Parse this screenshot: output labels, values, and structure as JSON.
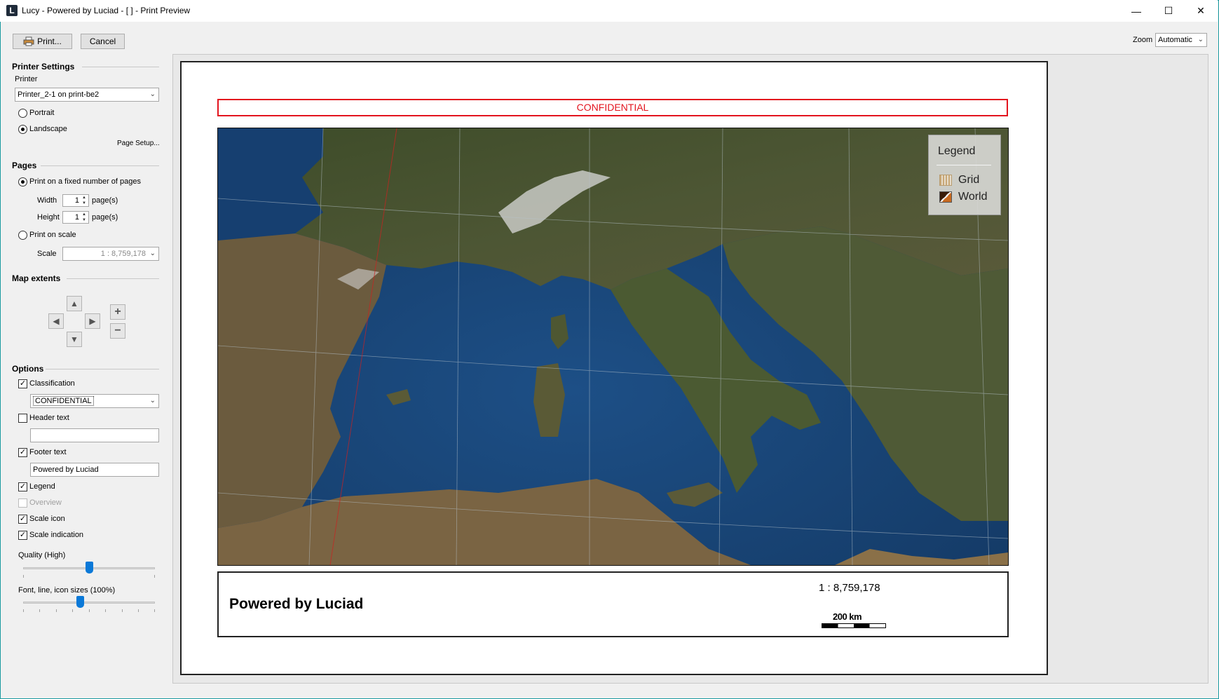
{
  "window": {
    "title": "Lucy - Powered by Luciad - [ ] - Print Preview",
    "app_icon": "L",
    "controls": {
      "minimize": "—",
      "maximize": "☐",
      "close": "✕"
    }
  },
  "toolbar": {
    "print_label": "Print...",
    "cancel_label": "Cancel",
    "zoom_label": "Zoom",
    "zoom_value": "Automatic"
  },
  "printer_settings": {
    "heading": "Printer Settings",
    "printer_label": "Printer",
    "printer_value": "Printer_2-1 on print-be2",
    "portrait_label": "Portrait",
    "landscape_label": "Landscape",
    "orientation": "Landscape",
    "page_setup_label": "Page Setup..."
  },
  "pages": {
    "heading": "Pages",
    "fixed_pages_label": "Print on a fixed number of pages",
    "width_label": "Width",
    "width_value": "1",
    "height_label": "Height",
    "height_value": "1",
    "pages_unit": "page(s)",
    "print_on_scale_label": "Print on scale",
    "scale_label": "Scale",
    "scale_value": "1 : 8,759,178"
  },
  "map_extents": {
    "heading": "Map extents"
  },
  "options": {
    "heading": "Options",
    "classification_label": "Classification",
    "classification_checked": true,
    "classification_value": "CONFIDENTIAL",
    "header_text_label": "Header text",
    "header_text_checked": false,
    "header_text_value": "",
    "footer_text_label": "Footer text",
    "footer_text_checked": true,
    "footer_text_value": "Powered by Luciad",
    "legend_label": "Legend",
    "legend_checked": true,
    "overview_label": "Overview",
    "overview_checked": false,
    "scale_icon_label": "Scale icon",
    "scale_icon_checked": true,
    "scale_indication_label": "Scale indication",
    "scale_indication_checked": true,
    "quality_label": "Quality (High)",
    "quality_level": 0.5,
    "font_sizes_label": "Font, line, icon sizes (100%)",
    "font_sizes_level": 0.4
  },
  "preview": {
    "classification_banner": "CONFIDENTIAL",
    "legend_title": "Legend",
    "legend_items": [
      "Grid",
      "World"
    ],
    "footer_text": "Powered by Luciad",
    "scale_text": "1 : 8,759,178",
    "scale_bar_label": "200 km"
  },
  "colors": {
    "classification_red": "#e3141e",
    "accent_blue": "#0b79d8",
    "window_border": "#1a9aa0"
  }
}
